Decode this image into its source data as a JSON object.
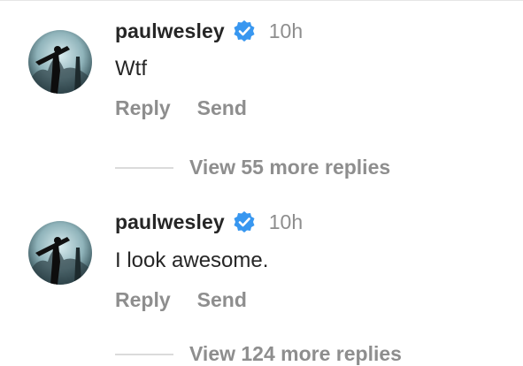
{
  "comments": [
    {
      "username": "paulwesley",
      "time": "10h",
      "text": "Wtf",
      "reply_label": "Reply",
      "send_label": "Send"
    },
    {
      "username": "paulwesley",
      "time": "10h",
      "text": "I look awesome.",
      "reply_label": "Reply",
      "send_label": "Send"
    }
  ],
  "view_more": [
    {
      "label": "View 55 more replies"
    },
    {
      "label": "View 124 more replies"
    }
  ],
  "colors": {
    "verified_badge": "#3897f0",
    "secondary_text": "#8e8e8e",
    "primary_text": "#262626"
  }
}
